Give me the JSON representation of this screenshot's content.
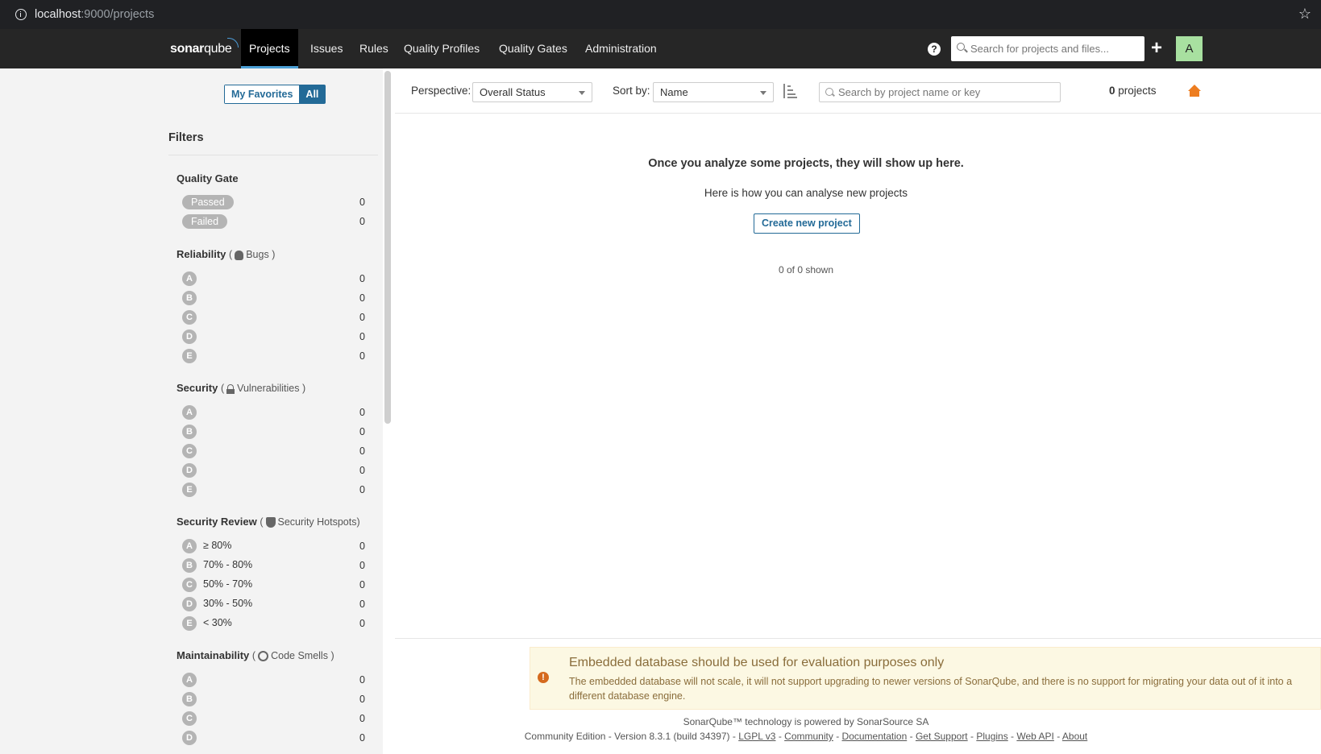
{
  "browser": {
    "url_host": "localhost",
    "url_rest": ":9000/projects"
  },
  "nav": {
    "logo": {
      "main": "sonar",
      "accent": "qube"
    },
    "items": [
      {
        "label": "Projects"
      },
      {
        "label": "Issues"
      },
      {
        "label": "Rules"
      },
      {
        "label": "Quality Profiles"
      },
      {
        "label": "Quality Gates"
      },
      {
        "label": "Administration"
      }
    ],
    "help": "?",
    "search_placeholder": "Search for projects and files...",
    "add": "+",
    "avatar": "A"
  },
  "sidebar": {
    "my_favorites": "My Favorites",
    "all": "All",
    "filters_title": "Filters",
    "quality_gate": {
      "title": "Quality Gate",
      "options": [
        {
          "label": "Passed",
          "count": "0"
        },
        {
          "label": "Failed",
          "count": "0"
        }
      ]
    },
    "reliability": {
      "title": "Reliability",
      "open": "(",
      "sub": "Bugs",
      "close": ")",
      "ratings": [
        {
          "label": "A",
          "count": "0"
        },
        {
          "label": "B",
          "count": "0"
        },
        {
          "label": "C",
          "count": "0"
        },
        {
          "label": "D",
          "count": "0"
        },
        {
          "label": "E",
          "count": "0"
        }
      ]
    },
    "security": {
      "title": "Security",
      "open": "(",
      "sub": "Vulnerabilities",
      "close": ")",
      "ratings": [
        {
          "label": "A",
          "count": "0"
        },
        {
          "label": "B",
          "count": "0"
        },
        {
          "label": "C",
          "count": "0"
        },
        {
          "label": "D",
          "count": "0"
        },
        {
          "label": "E",
          "count": "0"
        }
      ]
    },
    "security_review": {
      "title": "Security Review",
      "open": "(",
      "sub": "Security Hotspots",
      "close": ")",
      "ratings": [
        {
          "label": "A",
          "range": "≥ 80%",
          "count": "0"
        },
        {
          "label": "B",
          "range": "70% - 80%",
          "count": "0"
        },
        {
          "label": "C",
          "range": "50% - 70%",
          "count": "0"
        },
        {
          "label": "D",
          "range": "30% - 50%",
          "count": "0"
        },
        {
          "label": "E",
          "range": "< 30%",
          "count": "0"
        }
      ]
    },
    "maintainability": {
      "title": "Maintainability",
      "open": "(",
      "sub": "Code Smells",
      "close": ")",
      "ratings": [
        {
          "label": "A",
          "count": "0"
        },
        {
          "label": "B",
          "count": "0"
        },
        {
          "label": "C",
          "count": "0"
        },
        {
          "label": "D",
          "count": "0"
        }
      ]
    }
  },
  "toolbar": {
    "perspective_label": "Perspective:",
    "perspective_value": "Overall Status",
    "sort_label": "Sort by:",
    "sort_value": "Name",
    "search_placeholder": "Search by project name or key",
    "count_number": "0",
    "count_label": "projects"
  },
  "empty": {
    "title": "Once you analyze some projects, they will show up here.",
    "subtitle": "Here is how you can analyse new projects",
    "create_button": "Create new project",
    "shown": "0 of 0 shown"
  },
  "warning": {
    "icon": "!",
    "title": "Embedded database should be used for evaluation purposes only",
    "text": "The embedded database will not scale, it will not support upgrading to newer versions of SonarQube, and there is no support for migrating your data out of it into a different database engine."
  },
  "footer": {
    "powered_prefix": "SonarQube™ technology is powered by",
    "powered_link": "SonarSource SA",
    "version": "Community Edition - Version 8.3.1 (build 34397) -",
    "links": [
      "LGPL v3",
      "Community",
      "Documentation",
      "Get Support",
      "Plugins",
      "Web API",
      "About"
    ],
    "separator": "-"
  },
  "colors": {
    "nav_bg": "#262626",
    "accent": "#236a97",
    "home": "#ed7d20",
    "avatar": "#a8e0a0",
    "warning_bg": "#fcf8e3"
  }
}
